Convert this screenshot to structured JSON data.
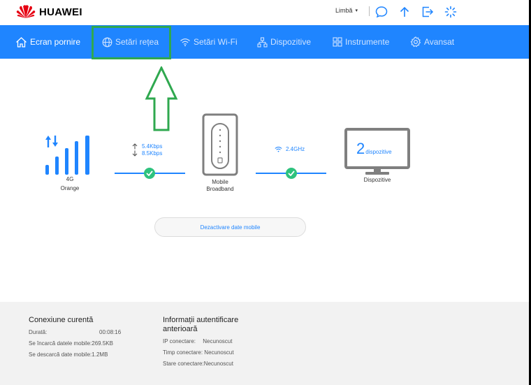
{
  "header": {
    "brand": "HUAWEI",
    "language_label": "Limbă",
    "icons": [
      "chat-icon",
      "upload-icon",
      "logout-icon",
      "loading-icon"
    ]
  },
  "nav": {
    "items": [
      {
        "label": "Ecran pornire",
        "icon": "home-icon"
      },
      {
        "label": "Setări rețea",
        "icon": "globe-icon"
      },
      {
        "label": "Setări Wi-Fi",
        "icon": "wifi-icon"
      },
      {
        "label": "Dispozitive",
        "icon": "devices-icon"
      },
      {
        "label": "Instrumente",
        "icon": "tools-icon"
      },
      {
        "label": "Avansat",
        "icon": "settings-icon"
      }
    ],
    "highlighted_index": 1,
    "colors": {
      "bar": "#1f85ff",
      "highlight": "#2fa84f"
    }
  },
  "status": {
    "network_type": "4G",
    "operator": "Orange",
    "upload_speed": "5.4Kbps",
    "download_speed": "8.5Kbps",
    "router_label_line1": "Mobile",
    "router_label_line2": "Broadband",
    "wifi_band": "2.4GHz",
    "device_count": "2",
    "device_count_suffix": "dispozitive",
    "devices_label": "Dispozitive",
    "mobile_data_button": "Dezactivare date mobile"
  },
  "footer": {
    "current": {
      "title": "Conexiune curentă",
      "duration_label": "Durată:",
      "duration_value": "00:08:16",
      "upload_label": "Se încarcă datele mobile:",
      "upload_value": "269.5KB",
      "download_label": "Se descarcă date mobile:",
      "download_value": "1.2MB"
    },
    "previous": {
      "title_line1": "Informații autentificare",
      "title_line2": "anterioară",
      "ip_label": "IP conectare:",
      "ip_value": "Necunoscut",
      "time_label": "Timp conectare:",
      "time_value": "Necunoscut",
      "state_label": "Stare conectare:",
      "state_value": "Necunoscut"
    }
  }
}
